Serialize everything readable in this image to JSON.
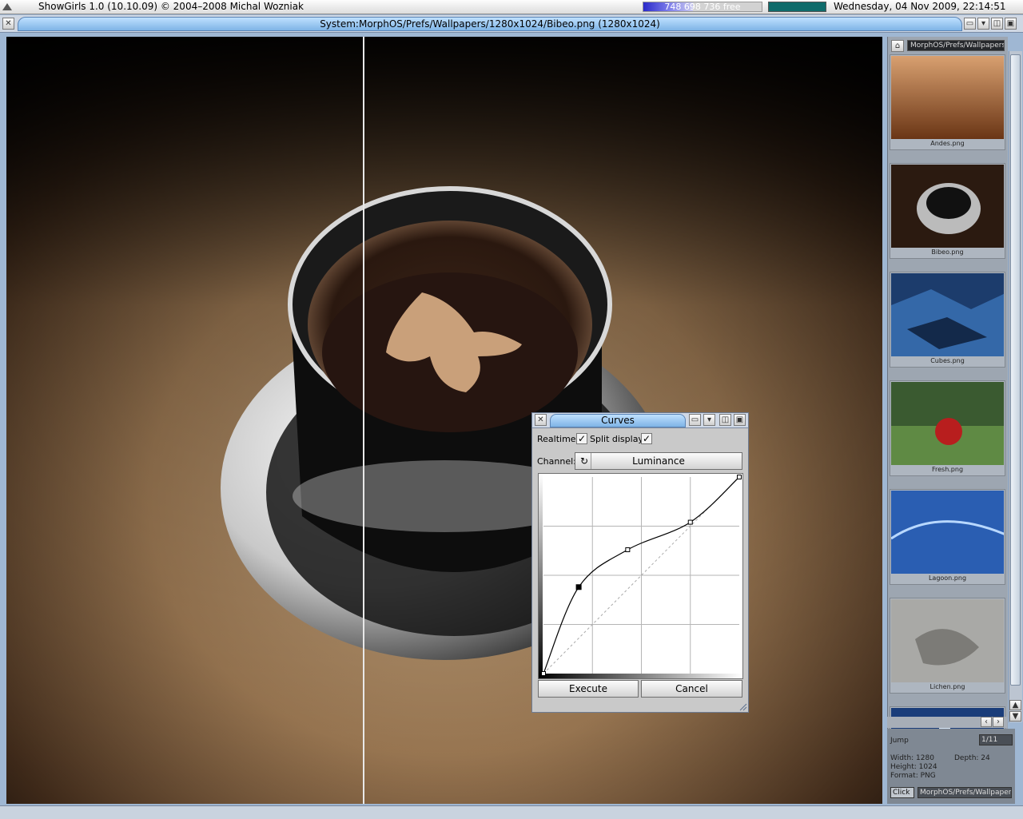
{
  "screen": {
    "title": "ShowGirls 1.0 (10.10.09) © 2004–2008 Michal Wozniak",
    "memory_text": "748 698 736 free",
    "memory_fraction": 0.42,
    "cpu_fraction": 0.0,
    "clock": "Wednesday, 04 Nov 2009, 22:14:51"
  },
  "window": {
    "title": "System:MorphOS/Prefs/Wallpapers/1280x1024/Bibeo.png (1280x1024)"
  },
  "thumbnails": {
    "folder": "MorphOS/Prefs/Wallpapers/1280x1024",
    "items": [
      {
        "caption": "Andes.png"
      },
      {
        "caption": "Bibeo.png"
      },
      {
        "caption": "Cubes.png"
      },
      {
        "caption": "Fresh.png"
      },
      {
        "caption": "Lagoon.png"
      },
      {
        "caption": "Lichen.png"
      },
      {
        "caption": ""
      }
    ],
    "info": {
      "jump_label": "Jump",
      "box1": "1/11",
      "lines": [
        "Width: 1280",
        "Height: 1024",
        "Depth: 24",
        "Format: PNG"
      ],
      "click_label": "Click",
      "path_box": "MorphOS/Prefs/Wallpapers/"
    }
  },
  "curves_dialog": {
    "title": "Curves",
    "realtime_label": "Realtime:",
    "realtime_checked": "✓",
    "split_label": "Split display:",
    "split_checked": "✓",
    "channel_label": "Channel:",
    "channel_value": "Luminance",
    "execute_label": "Execute",
    "cancel_label": "Cancel",
    "curve_points": [
      {
        "in": 0,
        "out": 0
      },
      {
        "in": 0.18,
        "out": 0.44
      },
      {
        "in": 0.43,
        "out": 0.63
      },
      {
        "in": 0.75,
        "out": 0.77
      },
      {
        "in": 1,
        "out": 1
      }
    ]
  },
  "colors": {
    "accent": "#7fb4e6",
    "panel": "#9da6b1"
  }
}
